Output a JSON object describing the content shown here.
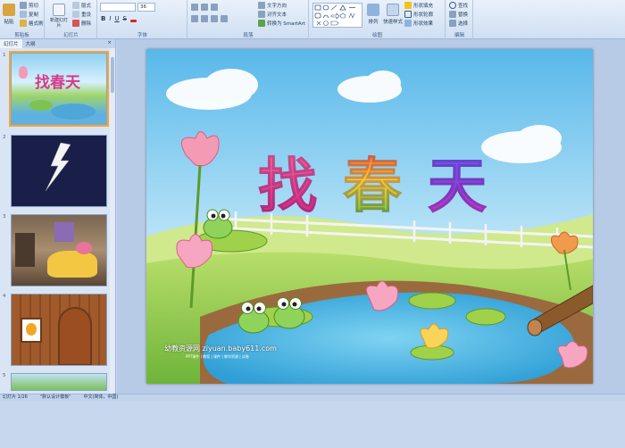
{
  "ribbon": {
    "clipboard": {
      "paste": "粘贴",
      "cut": "剪切",
      "copy": "复制",
      "format_painter": "格式刷",
      "label": "剪贴板"
    },
    "slides": {
      "new_slide": "新建幻灯片",
      "layout": "版式",
      "reset": "重设",
      "delete": "删除",
      "label": "幻灯片"
    },
    "font": {
      "font_name": "",
      "font_size": "36",
      "label": "字体"
    },
    "paragraph": {
      "text_direction": "文字方向",
      "align_text": "对齐文本",
      "smartart": "转换为 SmartArt",
      "label": "段落"
    },
    "drawing": {
      "arrange": "排列",
      "quick_styles": "快速样式",
      "shape_fill": "形状填充",
      "shape_outline": "形状轮廓",
      "shape_effects": "形状效果",
      "label": "绘图"
    },
    "editing": {
      "find": "查找",
      "replace": "替换",
      "select": "选择",
      "label": "编辑"
    }
  },
  "panel": {
    "tab_slides": "幻灯片",
    "tab_outline": "大纲",
    "close": "×",
    "thumbs": [
      {
        "num": "1",
        "title": "找春天"
      },
      {
        "num": "2",
        "title": ""
      },
      {
        "num": "3",
        "title": ""
      },
      {
        "num": "4",
        "title": ""
      },
      {
        "num": "5",
        "title": ""
      }
    ]
  },
  "slide": {
    "title_chars": [
      "找",
      "春",
      "天"
    ],
    "title_colors": [
      "#e62a8a",
      "#f0a020",
      "#7b3fd8"
    ],
    "watermark": "幼教资源网 ziyuan.baby611.com",
    "watermark_sub": "PPT课件 | 教案 | 课件 | 教学资源 | 试卷"
  },
  "status": {
    "slide_count": "幻灯片 1/26",
    "theme": "\"默认设计模板\"",
    "language": "中文(简体，中国)"
  }
}
